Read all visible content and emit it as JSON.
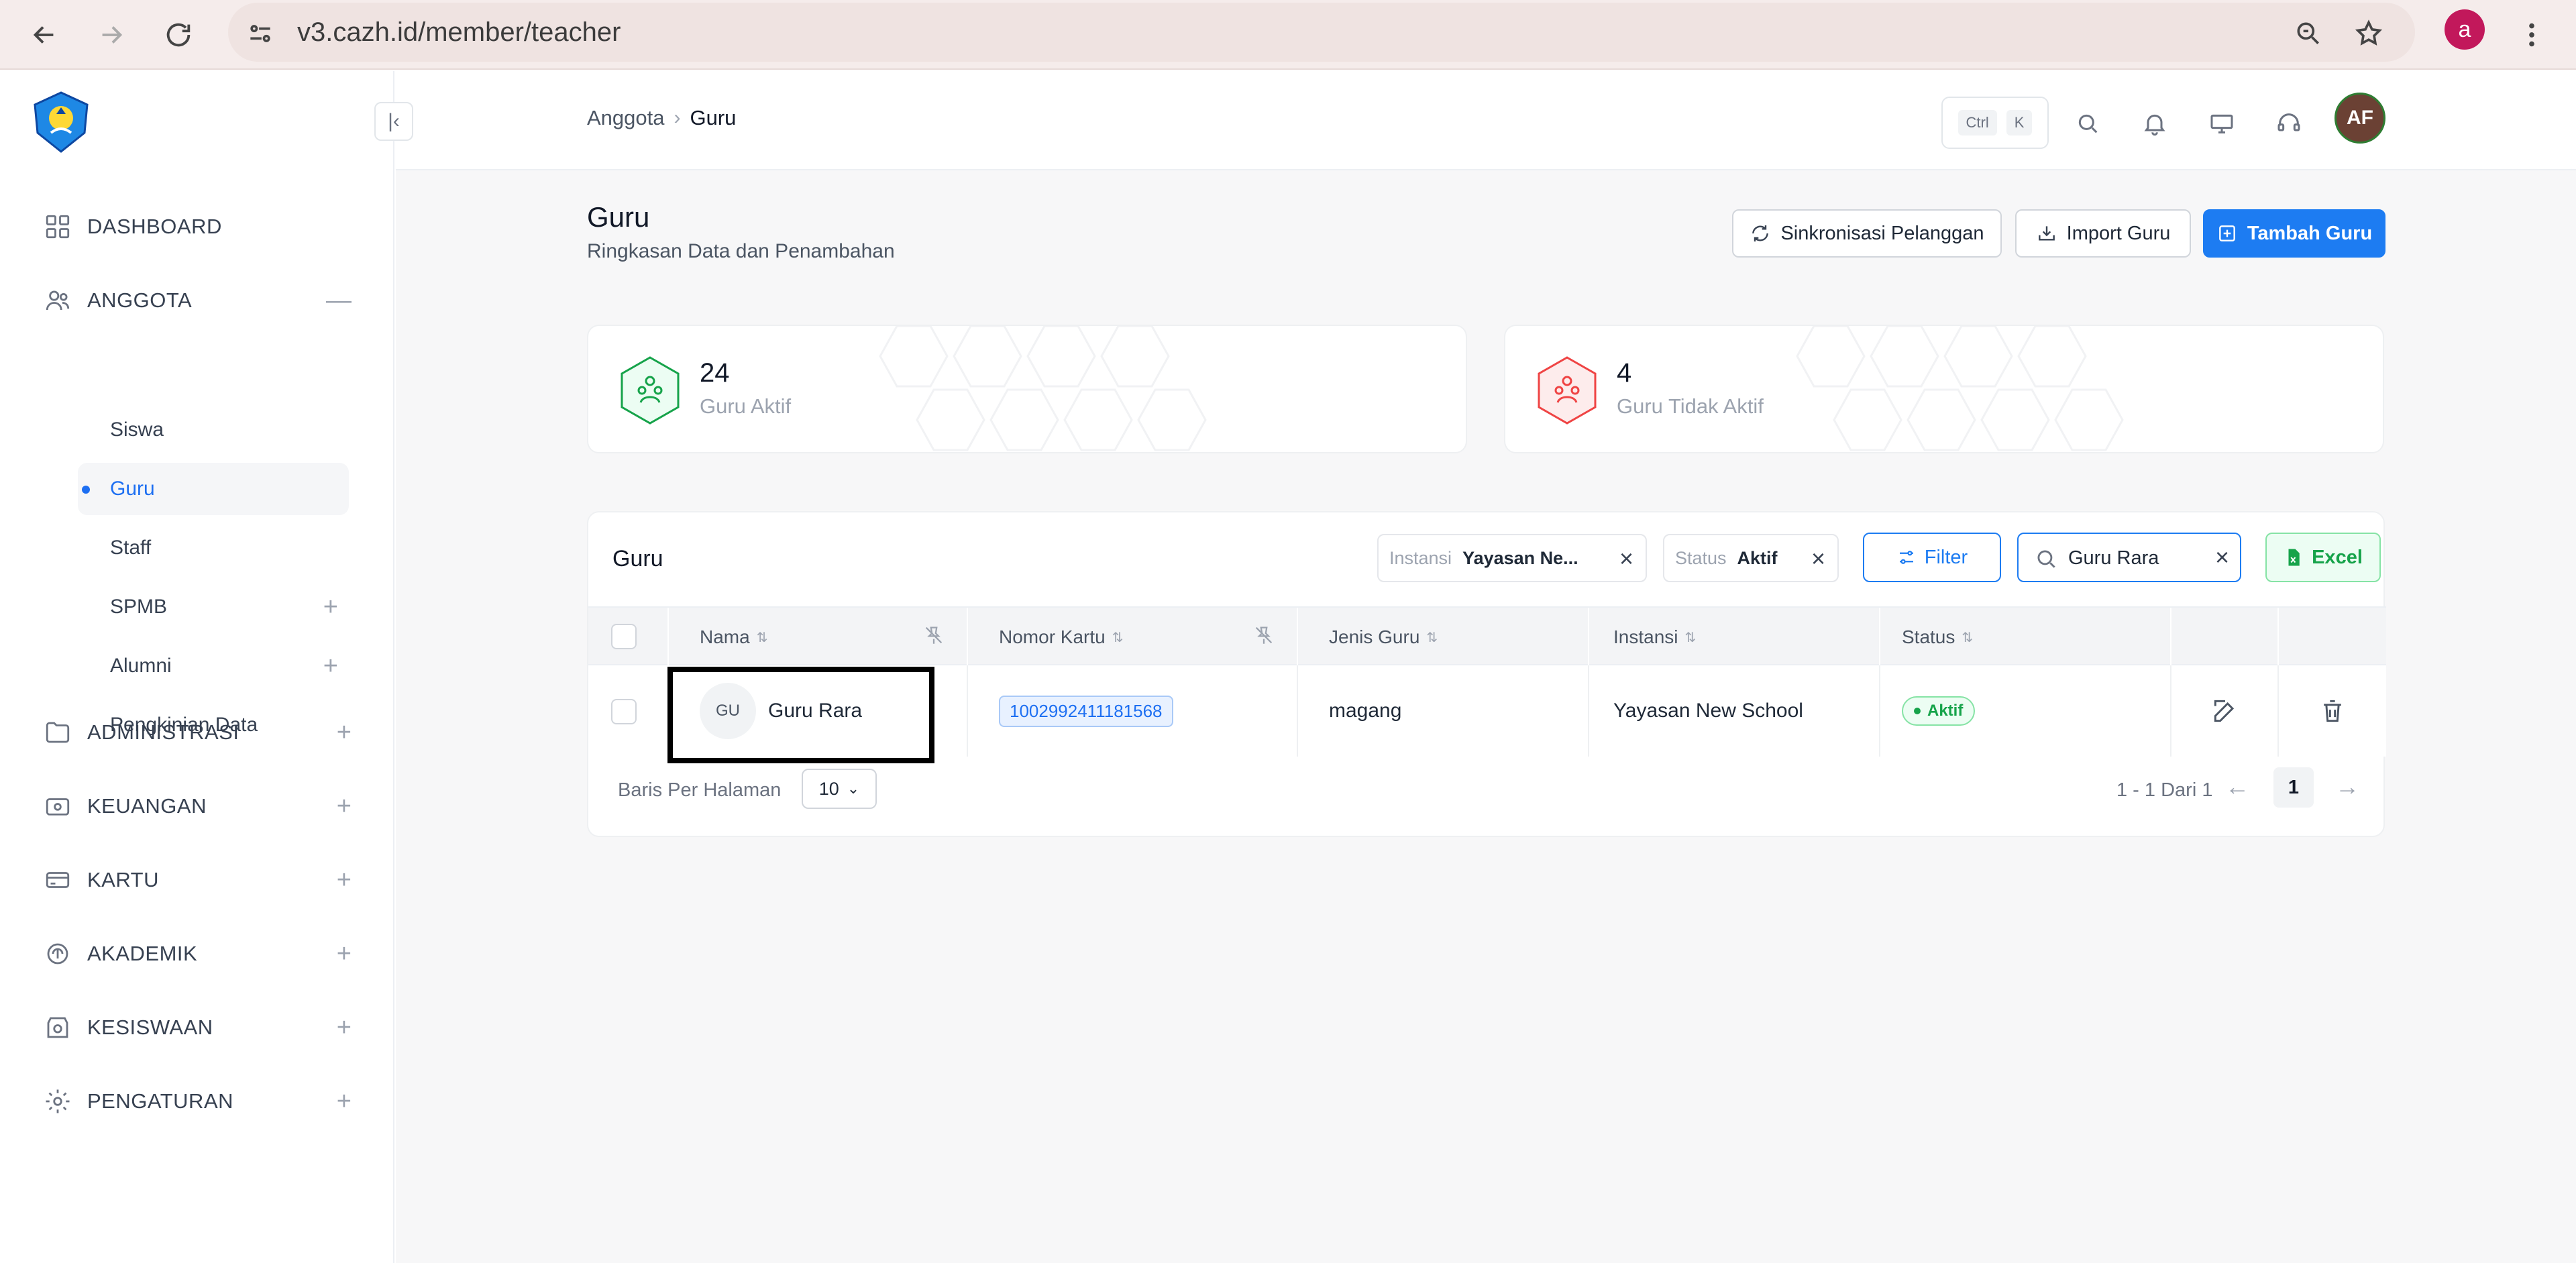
{
  "browser": {
    "url": "v3.cazh.id/member/teacher",
    "profile_initial": "a"
  },
  "sidebar": {
    "items": [
      {
        "label": "DASHBOARD",
        "icon": "grid-icon"
      },
      {
        "label": "ANGGOTA",
        "icon": "users-icon",
        "toggle": "—"
      },
      {
        "label": "ADMINISTRASI",
        "icon": "folder-icon",
        "toggle": "+"
      },
      {
        "label": "KEUANGAN",
        "icon": "wallet-icon",
        "toggle": "+"
      },
      {
        "label": "KARTU",
        "icon": "card-icon",
        "toggle": "+"
      },
      {
        "label": "AKADEMIK",
        "icon": "academic-icon",
        "toggle": "+"
      },
      {
        "label": "KESISWAAN",
        "icon": "student-icon",
        "toggle": "+"
      },
      {
        "label": "PENGATURAN",
        "icon": "gear-icon",
        "toggle": "+"
      }
    ],
    "anggota_sub": [
      {
        "label": "Siswa"
      },
      {
        "label": "Guru"
      },
      {
        "label": "Staff"
      },
      {
        "label": "SPMB",
        "toggle": "+"
      },
      {
        "label": "Alumni",
        "toggle": "+"
      },
      {
        "label": "Pengkinian Data"
      }
    ]
  },
  "topbar": {
    "breadcrumb": [
      "Anggota",
      "Guru"
    ],
    "breadcrumb_sep": "›",
    "kbd": [
      "Ctrl",
      "K"
    ],
    "avatar_initials": "AF"
  },
  "page": {
    "title": "Guru",
    "subtitle": "Ringkasan Data dan Penambahan",
    "buttons": {
      "sync": "Sinkronisasi Pelanggan",
      "import": "Import Guru",
      "add": "Tambah Guru"
    }
  },
  "stats": [
    {
      "value": "24",
      "label": "Guru Aktif",
      "color": "#16a34a"
    },
    {
      "value": "4",
      "label": "Guru Tidak Aktif",
      "color": "#ef4444"
    }
  ],
  "table": {
    "title": "Guru",
    "filters": [
      {
        "key": "Instansi",
        "value": "Yayasan Ne..."
      },
      {
        "key": "Status",
        "value": "Aktif"
      }
    ],
    "filter_button": "Filter",
    "search_value": "Guru Rara",
    "excel_button": "Excel",
    "columns": [
      "Nama",
      "Nomor Kartu",
      "Jenis Guru",
      "Instansi",
      "Status"
    ],
    "rows": [
      {
        "initials": "GU",
        "name": "Guru Rara",
        "card_number": "1002992411181568",
        "type": "magang",
        "institution": "Yayasan New School",
        "status": "Aktif"
      }
    ],
    "pagination": {
      "rows_label": "Baris Per Halaman",
      "rows_per_page": "10",
      "info": "1 - 1 Dari 1",
      "current_page": "1"
    }
  }
}
